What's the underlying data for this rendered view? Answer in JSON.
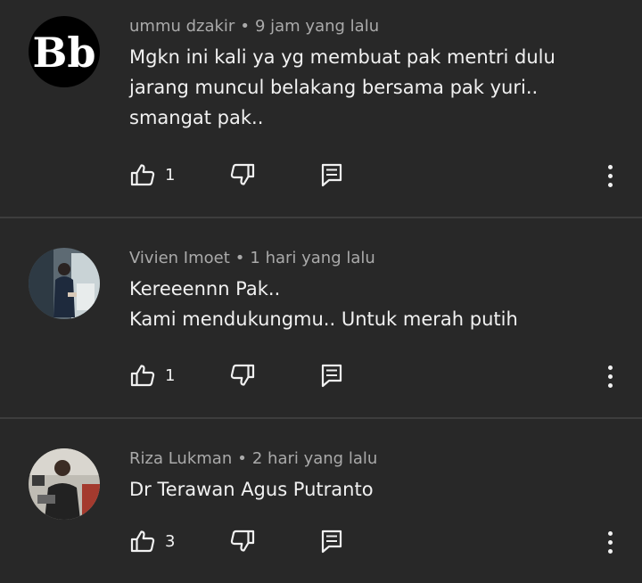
{
  "comments": [
    {
      "author": "ummu dzakir",
      "separator": "•",
      "time": "9 jam yang lalu",
      "lines": [
        "Mgkn ini kali ya yg membuat pak mentri dulu",
        "jarang muncul belakang bersama pak yuri..",
        "smangat pak.."
      ],
      "likes": "1",
      "avatar_text": "Bb"
    },
    {
      "author": "Vivien Imoet",
      "separator": "•",
      "time": "1 hari yang lalu",
      "lines": [
        "Kereeennn Pak..",
        "Kami mendukungmu.. Untuk merah putih"
      ],
      "likes": "1"
    },
    {
      "author": "Riza Lukman",
      "separator": "•",
      "time": "2 hari yang lalu",
      "lines": [
        "Dr Terawan Agus Putranto"
      ],
      "likes": "3"
    }
  ],
  "icons": {
    "like": "thumb-up-icon",
    "dislike": "thumb-down-icon",
    "reply": "reply-icon",
    "more": "more-vertical-icon"
  },
  "colors": {
    "background": "#282828",
    "text": "#f1f1f1",
    "meta": "#aaaaaa",
    "divider": "#3d3d3d"
  }
}
